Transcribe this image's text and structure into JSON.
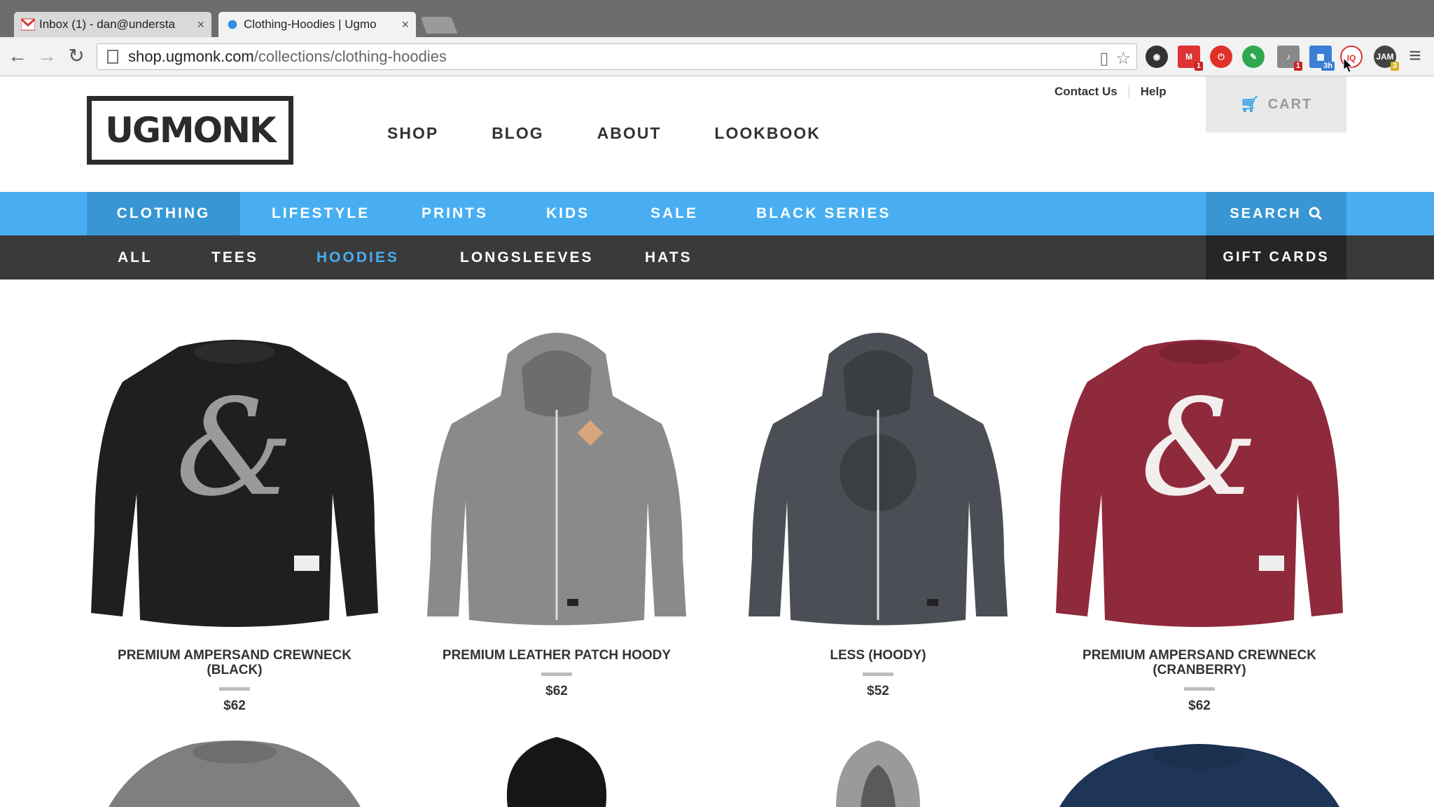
{
  "browser": {
    "tabs": [
      {
        "label": "Inbox (1) - dan@understa",
        "active": false
      },
      {
        "label": "Clothing-Hoodies | Ugmo",
        "active": true
      }
    ],
    "url_host": "shop.ugmonk.com",
    "url_path": "/collections/clothing-hoodies",
    "extension_badges": [
      "1",
      "1",
      "3h",
      "3"
    ]
  },
  "site": {
    "logo_text": "UGMONK",
    "nav": [
      "SHOP",
      "BLOG",
      "ABOUT",
      "LOOKBOOK"
    ],
    "top_links": [
      "Contact Us",
      "Help"
    ],
    "cart_label": "CART",
    "categories": [
      "CLOTHING",
      "LIFESTYLE",
      "PRINTS",
      "KIDS",
      "SALE",
      "BLACK SERIES"
    ],
    "active_category": "CLOTHING",
    "search_label": "SEARCH",
    "subcategories": [
      "ALL",
      "TEES",
      "HOODIES",
      "LONGSLEEVES",
      "HATS"
    ],
    "active_subcategory": "HOODIES",
    "gift_cards_label": "GIFT CARDS"
  },
  "products": [
    {
      "name": "PREMIUM AMPERSAND CREWNECK (BLACK)",
      "price": "$62",
      "color": "#1f1f1f"
    },
    {
      "name": "PREMIUM LEATHER PATCH HOODY",
      "price": "$62",
      "color": "#8a8a8a"
    },
    {
      "name": "LESS (HOODY)",
      "price": "$52",
      "color": "#4b4f55"
    },
    {
      "name": "PREMIUM AMPERSAND CREWNECK (CRANBERRY)",
      "price": "$62",
      "color": "#8e2a3b"
    }
  ],
  "colors": {
    "blue": "#48aef1",
    "dark": "#3a3a3a"
  }
}
